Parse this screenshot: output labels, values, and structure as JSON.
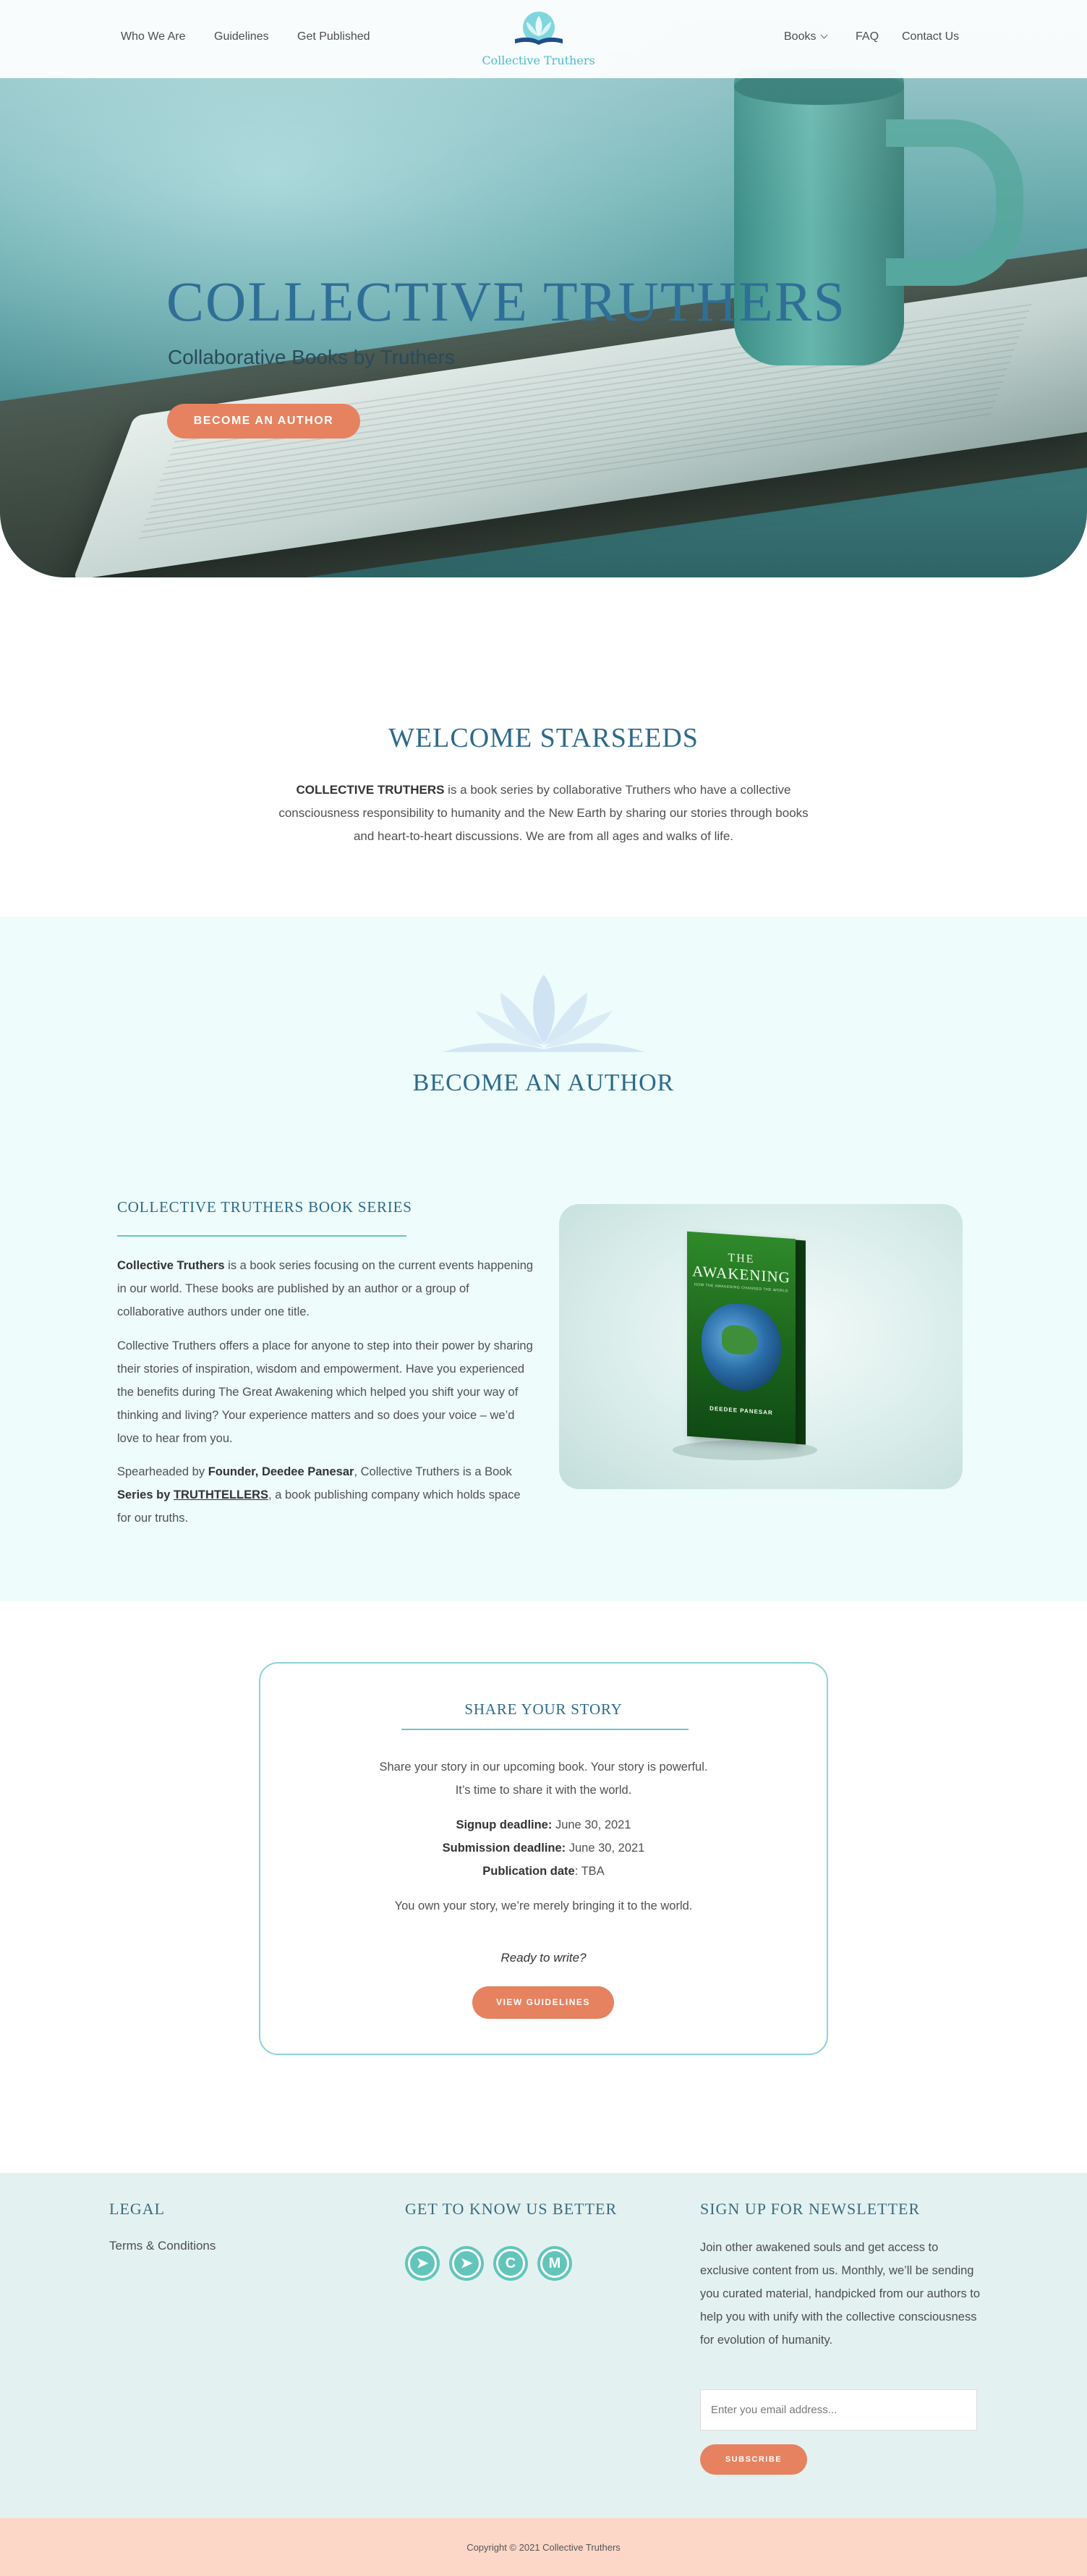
{
  "header": {
    "nav_left": [
      "Who We Are",
      "Guidelines",
      "Get Published"
    ],
    "logo_text": "Collective Truthers",
    "nav_right": {
      "books": "Books",
      "faq": "FAQ",
      "contact": "Contact Us"
    }
  },
  "hero": {
    "title": "COLLECTIVE TRUTHERS",
    "subtitle": "Collaborative Books by Truthers",
    "button": "BECOME AN AUTHOR"
  },
  "welcome": {
    "title": "WELCOME STARSEEDS",
    "bold": "COLLECTIVE TRUTHERS",
    "text": " is a book series by collaborative Truthers who have a collective consciousness responsibility to humanity and the New Earth by sharing our stories through books and heart-to-heart discussions.  We are from all ages and walks of life."
  },
  "author": {
    "title": "BECOME AN AUTHOR",
    "series_title": "COLLECTIVE TRUTHERS BOOK SERIES",
    "p1_bold": "Collective Truthers",
    "p1_text": " is a book series focusing on the current events happening in our world. These books are published by an author or a group of collaborative authors under one title.",
    "p2": "Collective Truthers offers a place for anyone to step into their power by sharing their stories of inspiration, wisdom and empowerment. Have you experienced the benefits during The Great Awakening which helped you shift your way of thinking and living? Your experience matters and so does your voice – we’d love to hear from you.",
    "p3_a": "Spearheaded by ",
    "p3_founder": "Founder, Deedee Panesar",
    "p3_b": ", Collective Truthers is a Book ",
    "p3_series": "Series by ",
    "p3_company": "TRUTHTELLERS",
    "p3_c": ", a book publishing company which holds space for our truths.",
    "book": {
      "line1": "THE",
      "line2": "AWAKENING",
      "line3": "HOW THE AWAKENING CHANGED THE WORLD",
      "author": "DEEDEE PANESAR"
    }
  },
  "share": {
    "title": "SHARE YOUR STORY",
    "line1": "Share your story in our upcoming book. Your story is powerful.",
    "line2": "It’s time to share it with the world.",
    "signup_label": "Signup deadline:",
    "signup_value": " June 30, 2021",
    "submission_label": "Submission deadline:",
    "submission_value": " June 30, 2021",
    "publication_label": "Publication date",
    "publication_value": ": TBA",
    "own_story": "You own your story, we’re merely bringing it to the world.",
    "ready": "Ready to write?",
    "button": "VIEW GUIDELINES"
  },
  "footer": {
    "legal_title": "LEGAL",
    "terms": "Terms & Conditions",
    "social_title": "GET TO KNOW US BETTER",
    "social_icons": [
      "telegram-icon",
      "telegram-icon",
      "c-icon",
      "m-icon"
    ],
    "newsletter_title": "SIGN UP FOR NEWSLETTER",
    "newsletter_text": "Join other awakened souls and get access to exclusive content from us. Monthly, we’ll be sending you curated material, handpicked from our authors to help you with unify with the collective consciousness for evolution of humanity.",
    "email_placeholder": "Enter you email address...",
    "subscribe": "SUBSCRIBE",
    "copyright": "Copyright © 2021 Collective Truthers"
  },
  "colors": {
    "accent": "#e6825f",
    "heading": "#2d6a8c",
    "teal": "#68c7c0",
    "author_bg": "#eefcfb",
    "footer_bg": "#e3f2f1",
    "copyright_bg": "#fcd7c8"
  }
}
